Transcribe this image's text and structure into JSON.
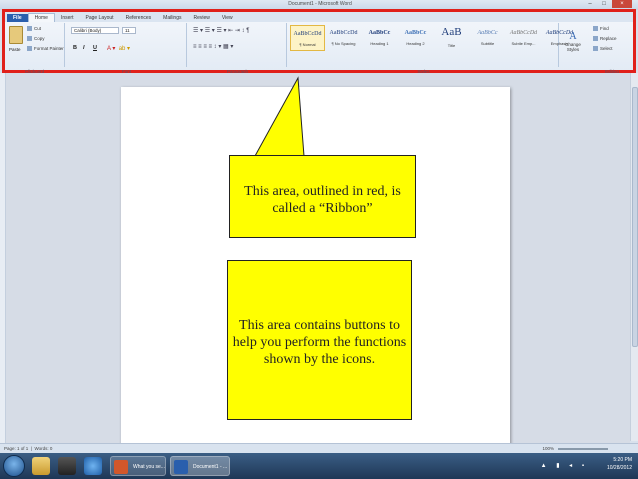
{
  "window": {
    "title": "Document1 - Microsoft Word"
  },
  "ribbon": {
    "tabs": [
      "File",
      "Home",
      "Insert",
      "Page Layout",
      "References",
      "Mailings",
      "Review",
      "View"
    ],
    "clipboard": {
      "paste": "Paste",
      "cut": "Cut",
      "copy": "Copy",
      "format_painter": "Format Painter",
      "label": "Clipboard"
    },
    "font": {
      "name": "Calibri (Body)",
      "size": "11",
      "label": "Font",
      "bold": "B",
      "italic": "I",
      "underline": "U"
    },
    "paragraph": {
      "label": "Paragraph"
    },
    "styles": {
      "label": "Styles",
      "items": [
        {
          "sample": "AaBbCcDd",
          "name": "¶ Normal"
        },
        {
          "sample": "AaBbCcDd",
          "name": "¶ No Spacing"
        },
        {
          "sample": "AaBbCc",
          "name": "Heading 1"
        },
        {
          "sample": "AaBbCc",
          "name": "Heading 2"
        },
        {
          "sample": "AaB",
          "name": "Title"
        },
        {
          "sample": "AaBbCc",
          "name": "Subtitle"
        },
        {
          "sample": "AaBbCcDd",
          "name": "Subtle Emp..."
        },
        {
          "sample": "AaBbCcDd",
          "name": "Emphasis"
        }
      ],
      "change_styles": "Change Styles"
    },
    "editing": {
      "find": "Find",
      "replace": "Replace",
      "select": "Select",
      "label": "Editing"
    }
  },
  "callouts": {
    "ribbon": "This area, outlined in red, is called a “Ribbon”",
    "buttons": "This area contains buttons to help you perform the functions shown by the icons."
  },
  "statusbar": {
    "page": "Page: 1 of 1",
    "words": "Words: 0",
    "zoom": "100%"
  },
  "taskbar": {
    "tasks": [
      "What you se...",
      "Document1 - ..."
    ],
    "time": "5:20 PM",
    "date": "10/28/2012"
  },
  "colors": {
    "ribbon_outline": "#e0201a",
    "callout_fill": "#ffff00",
    "file_tab": "#2a5fad"
  }
}
